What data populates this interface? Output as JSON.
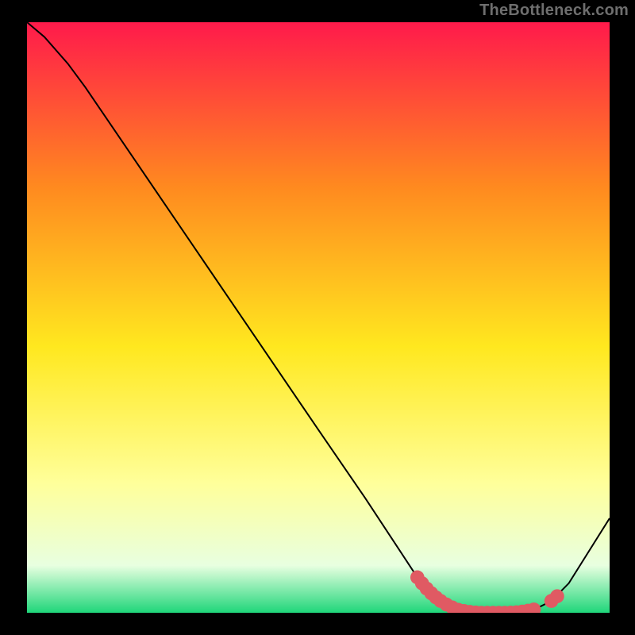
{
  "watermark": "TheBottleneck.com",
  "chart_data": {
    "type": "line",
    "title": "",
    "xlabel": "",
    "ylabel": "",
    "xlim": [
      0,
      100
    ],
    "ylim": [
      0,
      100
    ],
    "background_gradient": {
      "top": "#ff1a4b",
      "mid1": "#ff8a1f",
      "mid2": "#ffe81f",
      "mid3": "#ffff9a",
      "mid4": "#e8ffe0",
      "bottom": "#1fd67a"
    },
    "curve": [
      {
        "x": 0,
        "y": 100.0
      },
      {
        "x": 3,
        "y": 97.5
      },
      {
        "x": 7,
        "y": 93.0
      },
      {
        "x": 10,
        "y": 89.0
      },
      {
        "x": 20,
        "y": 74.5
      },
      {
        "x": 30,
        "y": 60.0
      },
      {
        "x": 40,
        "y": 45.5
      },
      {
        "x": 50,
        "y": 31.0
      },
      {
        "x": 58,
        "y": 19.5
      },
      {
        "x": 63,
        "y": 12.0
      },
      {
        "x": 67,
        "y": 6.0
      },
      {
        "x": 70,
        "y": 2.5
      },
      {
        "x": 73,
        "y": 0.8
      },
      {
        "x": 78,
        "y": 0.0
      },
      {
        "x": 83,
        "y": 0.0
      },
      {
        "x": 87,
        "y": 0.5
      },
      {
        "x": 90,
        "y": 2.0
      },
      {
        "x": 93,
        "y": 5.0
      },
      {
        "x": 100,
        "y": 16.0
      }
    ],
    "curve_color": "#000000",
    "markers": [
      {
        "x": 67.0,
        "y": 6.0
      },
      {
        "x": 67.8,
        "y": 5.0
      },
      {
        "x": 68.6,
        "y": 4.1
      },
      {
        "x": 69.4,
        "y": 3.3
      },
      {
        "x": 70.2,
        "y": 2.6
      },
      {
        "x": 71.0,
        "y": 2.0
      },
      {
        "x": 72.0,
        "y": 1.4
      },
      {
        "x": 73.0,
        "y": 0.9
      },
      {
        "x": 74.0,
        "y": 0.5
      },
      {
        "x": 75.0,
        "y": 0.3
      },
      {
        "x": 76.0,
        "y": 0.15
      },
      {
        "x": 77.0,
        "y": 0.05
      },
      {
        "x": 78.0,
        "y": 0.0
      },
      {
        "x": 79.0,
        "y": 0.0
      },
      {
        "x": 80.0,
        "y": 0.0
      },
      {
        "x": 81.0,
        "y": 0.0
      },
      {
        "x": 82.0,
        "y": 0.0
      },
      {
        "x": 83.0,
        "y": 0.02
      },
      {
        "x": 84.0,
        "y": 0.08
      },
      {
        "x": 85.0,
        "y": 0.2
      },
      {
        "x": 86.0,
        "y": 0.35
      },
      {
        "x": 87.0,
        "y": 0.55
      },
      {
        "x": 90.0,
        "y": 2.0
      },
      {
        "x": 91.0,
        "y": 2.8
      }
    ],
    "marker_color": "#e05a63",
    "marker_radius": 1.2
  }
}
